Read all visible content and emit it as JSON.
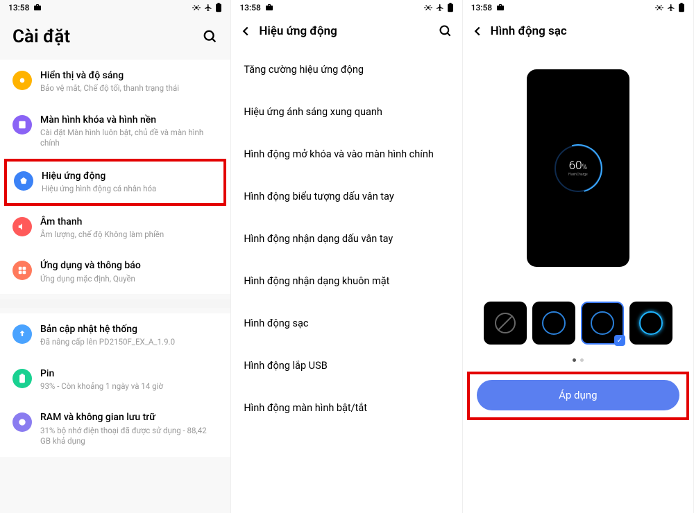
{
  "status": {
    "time": "13:58"
  },
  "panel1": {
    "title": "Cài đặt",
    "items": [
      {
        "title": "Hiển thị và độ sáng",
        "sub": "Bảo vệ mắt, Chế độ tối, thanh trạng thái",
        "color": "#ffb300"
      },
      {
        "title": "Màn hình khóa và hình nền",
        "sub": "Cài đặt Màn hình luôn bật, chủ đề và màn hình chính",
        "color": "#8a63f5"
      },
      {
        "title": "Hiệu ứng động",
        "sub": "Hiệu ứng hình động cá nhân hóa",
        "color": "#3b82f6",
        "highlight": true
      },
      {
        "title": "Âm thanh",
        "sub": "Âm lượng, chế độ Không làm phiền",
        "color": "#ff5a5a"
      },
      {
        "title": "Ứng dụng và thông báo",
        "sub": "Ứng dụng mặc định, Quyền",
        "color": "#ff7a5c"
      }
    ],
    "items2": [
      {
        "title": "Bản cập nhật hệ thống",
        "sub": "Đã nâng cấp lên PD2150F_EX_A_1.9.0",
        "color": "#4aa3ff"
      },
      {
        "title": "Pin",
        "sub": "93% - Còn khoảng 1 ngày và 14 giờ",
        "color": "#19d191"
      },
      {
        "title": "RAM và không gian lưu trữ",
        "sub": "31% bộ nhớ điện thoại đã được sử dụng - 88,42 GB khả dụng",
        "color": "#8a7cf0"
      }
    ]
  },
  "panel2": {
    "title": "Hiệu ứng động",
    "items": [
      "Tăng cường hiệu ứng động",
      "Hiệu ứng ánh sáng xung quanh",
      "Hình động mở khóa và vào màn hình chính",
      "Hình động biểu tượng dấu vân tay",
      "Hình động nhận dạng dấu vân tay",
      "Hình động nhận dạng khuôn mặt",
      "Hình động sạc",
      "Hình động lắp USB",
      "Hình động màn hình bật/tắt"
    ]
  },
  "panel3": {
    "title": "Hình động sạc",
    "charge_percent": "60",
    "charge_unit": "%",
    "charge_brand": "FlashCharge",
    "apply_label": "Áp dụng"
  }
}
